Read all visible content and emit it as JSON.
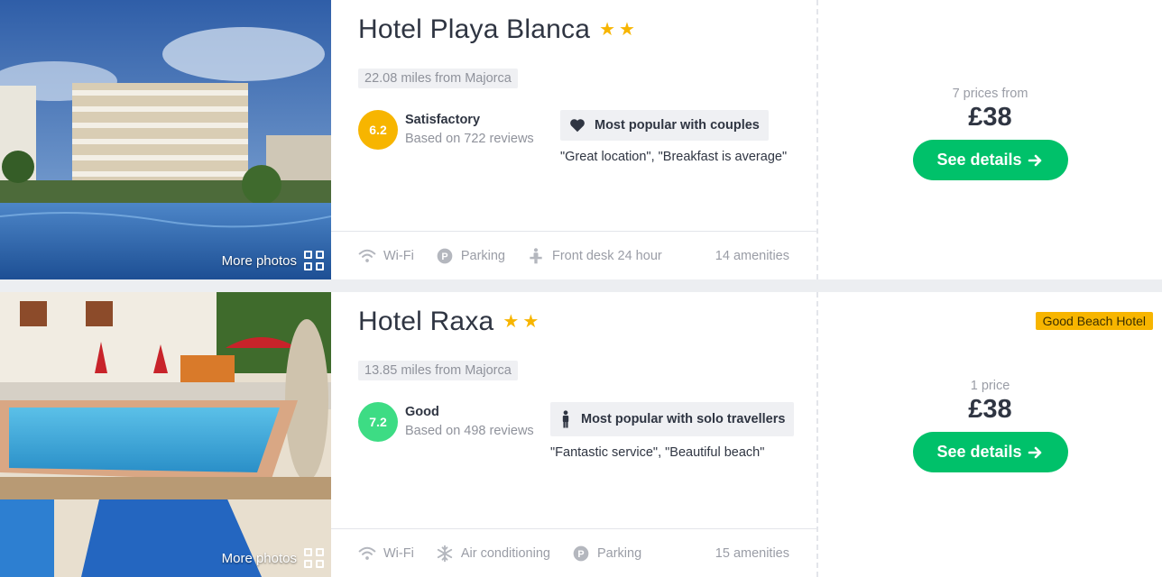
{
  "hotels": [
    {
      "name": "Hotel Playa Blanca",
      "stars": [
        "★",
        "★"
      ],
      "distance": "22.08 miles from Majorca",
      "score": "6.2",
      "score_color": "#f7b500",
      "rating_label": "Satisfactory",
      "rating_count": "Based on 722 reviews",
      "popular_icon": "heart-icon",
      "popular_label": "Most popular with couples",
      "popular_quote": "\"Great location\", \"Breakfast is average\"",
      "more_photos": "More photos",
      "amenities": [
        {
          "icon": "wifi-icon",
          "label": "Wi-Fi"
        },
        {
          "icon": "parking-icon",
          "label": "Parking"
        },
        {
          "icon": "front-desk-icon",
          "label": "Front desk 24 hour"
        }
      ],
      "amenity_count": "14 amenities",
      "prices_from": "7 prices from",
      "price": "£38",
      "details_button": "See details",
      "details_icon": "arrow-right-icon",
      "tag": ""
    },
    {
      "name": "Hotel Raxa",
      "stars": [
        "★",
        "★"
      ],
      "distance": "13.85 miles from Majorca",
      "score": "7.2",
      "score_color": "#3ddc84",
      "rating_label": "Good",
      "rating_count": "Based on 498 reviews",
      "popular_icon": "solo-traveller-icon",
      "popular_label": "Most popular with solo travellers",
      "popular_quote": "\"Fantastic service\", \"Beautiful beach\"",
      "more_photos": "More photos",
      "amenities": [
        {
          "icon": "wifi-icon",
          "label": "Wi-Fi"
        },
        {
          "icon": "snowflake-icon",
          "label": "Air conditioning"
        },
        {
          "icon": "parking-icon",
          "label": "Parking"
        }
      ],
      "amenity_count": "15 amenities",
      "prices_from": "1 price",
      "price": "£38",
      "details_button": "See details",
      "details_icon": "arrow-right-icon",
      "tag": "Good Beach Hotel"
    }
  ]
}
